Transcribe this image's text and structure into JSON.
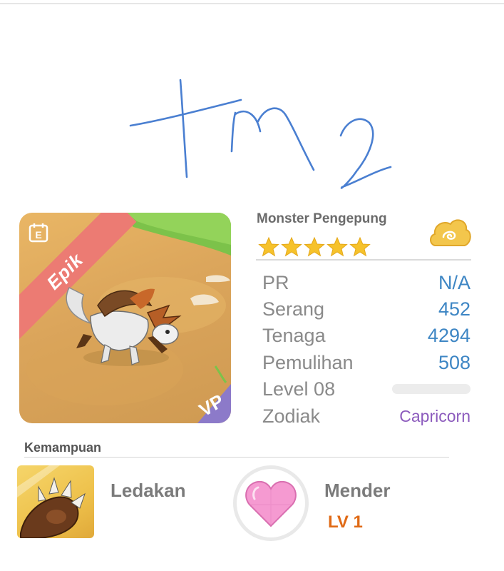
{
  "handwriting": {
    "text": "tm2",
    "color": "#4a7fd1"
  },
  "monster": {
    "rarity": "Epik",
    "rarity_color": "#ec7b73",
    "species": "Monster Pengepung",
    "stars": 5,
    "zodiac_icon": "cloud-icon"
  },
  "stats": [
    {
      "label": "PR",
      "value": "N/A"
    },
    {
      "label": "Serang",
      "value": "452"
    },
    {
      "label": "Tenaga",
      "value": "4294"
    },
    {
      "label": "Pemulihan",
      "value": "508"
    }
  ],
  "level": {
    "label": "Level 08",
    "progress": 0
  },
  "zodiac": {
    "label": "Zodiak",
    "value": "Capricorn"
  },
  "abilities": {
    "title": "Kemampuan",
    "items": [
      {
        "name": "Ledakan",
        "icon": "claw-icon"
      },
      {
        "name": "Mender",
        "icon": "heart-icon",
        "level": "LV 1"
      }
    ]
  },
  "colors": {
    "stat_value": "#3e86c4",
    "zodiac_value": "#8c5bbd",
    "level_badge": "#e06a16",
    "star": "#f6c22b"
  }
}
